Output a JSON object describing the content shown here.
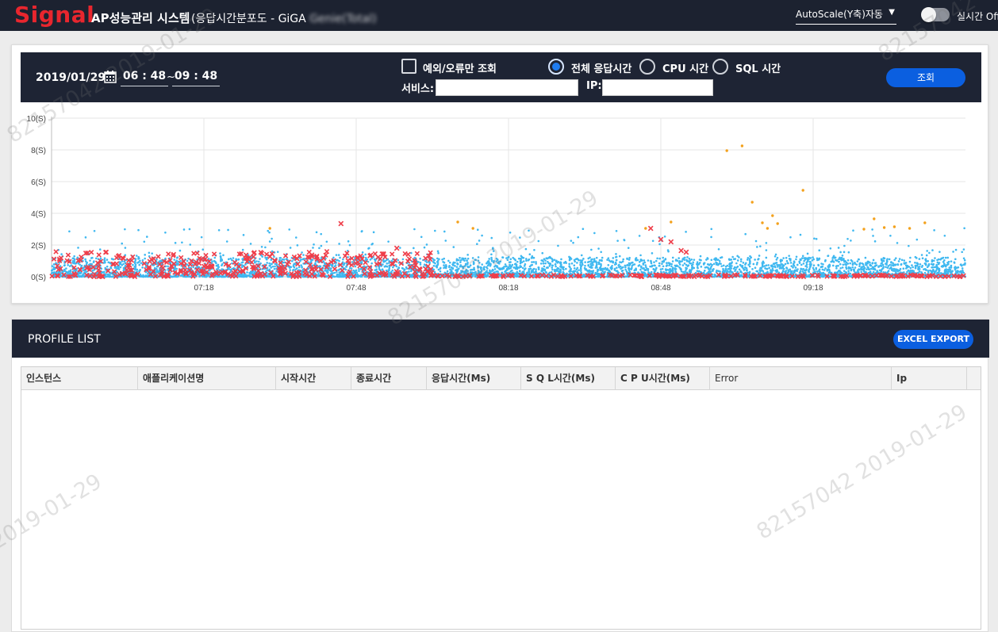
{
  "topbar": {
    "logo": "Signal",
    "title": "AP성능관리 시스템",
    "subtitle_prefix": "(응답시간분포도 - GiGA",
    "subtitle_blurred": "Genie(Total)",
    "autoscale_label": "AutoScale(Y축)자동",
    "realtime_label": "실시간 Off",
    "realtime_on": false
  },
  "filter": {
    "date": "2019/01/29",
    "time_from": "06 : 48",
    "time_separator": "~",
    "time_to": "09 : 48",
    "error_only_label": "예외/오류만 조회",
    "error_only_checked": false,
    "radio_options": [
      {
        "label": "전체 응답시간",
        "selected": true
      },
      {
        "label": "CPU 시간",
        "selected": false
      },
      {
        "label": "SQL 시간",
        "selected": false
      }
    ],
    "service_label": "서비스:",
    "service_value": "",
    "ip_label": "IP:",
    "ip_value": "",
    "search_button": "조회"
  },
  "chart_data": {
    "type": "scatter",
    "title": "",
    "xlabel": "",
    "ylabel": "",
    "x_ticks": [
      "07:18",
      "07:48",
      "08:18",
      "08:48",
      "09:18"
    ],
    "y_ticks": [
      "0(S)",
      "2(S)",
      "4(S)",
      "6(S)",
      "8(S)",
      "10(S)"
    ],
    "ylim": [
      0,
      10
    ],
    "xlim": [
      "06:48",
      "09:48"
    ],
    "grid": true,
    "series": [
      {
        "color": "#3fb8f0",
        "marker": "dot",
        "summary": "dense band of normal transactions 0–1.2 s across the full range, sparse outliers up to ~3 s"
      },
      {
        "color": "#ef3e4a",
        "marker": "x",
        "summary": "error transactions mostly 0–1.5 s, heavier 06:48–08:00"
      },
      {
        "color": "#f3a11c",
        "marker": "dot",
        "summary": "slow transactions",
        "points": [
          [
            "07:31",
            3.05
          ],
          [
            "08:08",
            3.45
          ],
          [
            "08:11",
            3.05
          ],
          [
            "08:45",
            3.05
          ],
          [
            "08:50",
            3.45
          ],
          [
            "09:01",
            7.95
          ],
          [
            "09:04",
            8.25
          ],
          [
            "09:06",
            4.7
          ],
          [
            "09:08",
            3.4
          ],
          [
            "09:09",
            3.05
          ],
          [
            "09:10",
            3.85
          ],
          [
            "09:11",
            3.35
          ],
          [
            "09:16",
            5.45
          ],
          [
            "09:28",
            3.0
          ],
          [
            "09:30",
            3.65
          ],
          [
            "09:32",
            3.1
          ],
          [
            "09:34",
            3.15
          ],
          [
            "09:37",
            3.05
          ],
          [
            "09:40",
            3.4
          ]
        ]
      }
    ]
  },
  "profile": {
    "title": "PROFILE LIST",
    "export_button": "EXCEL EXPORT",
    "columns": [
      "인스턴스",
      "애플리케이션명",
      "시작시간",
      "종료시간",
      "응답시간(Ms)",
      "S Q L시간(Ms)",
      "C P U시간(Ms)",
      "Error",
      "Ip"
    ],
    "rows": []
  },
  "watermark": {
    "id": "82157042",
    "date": "2019-01-29"
  }
}
